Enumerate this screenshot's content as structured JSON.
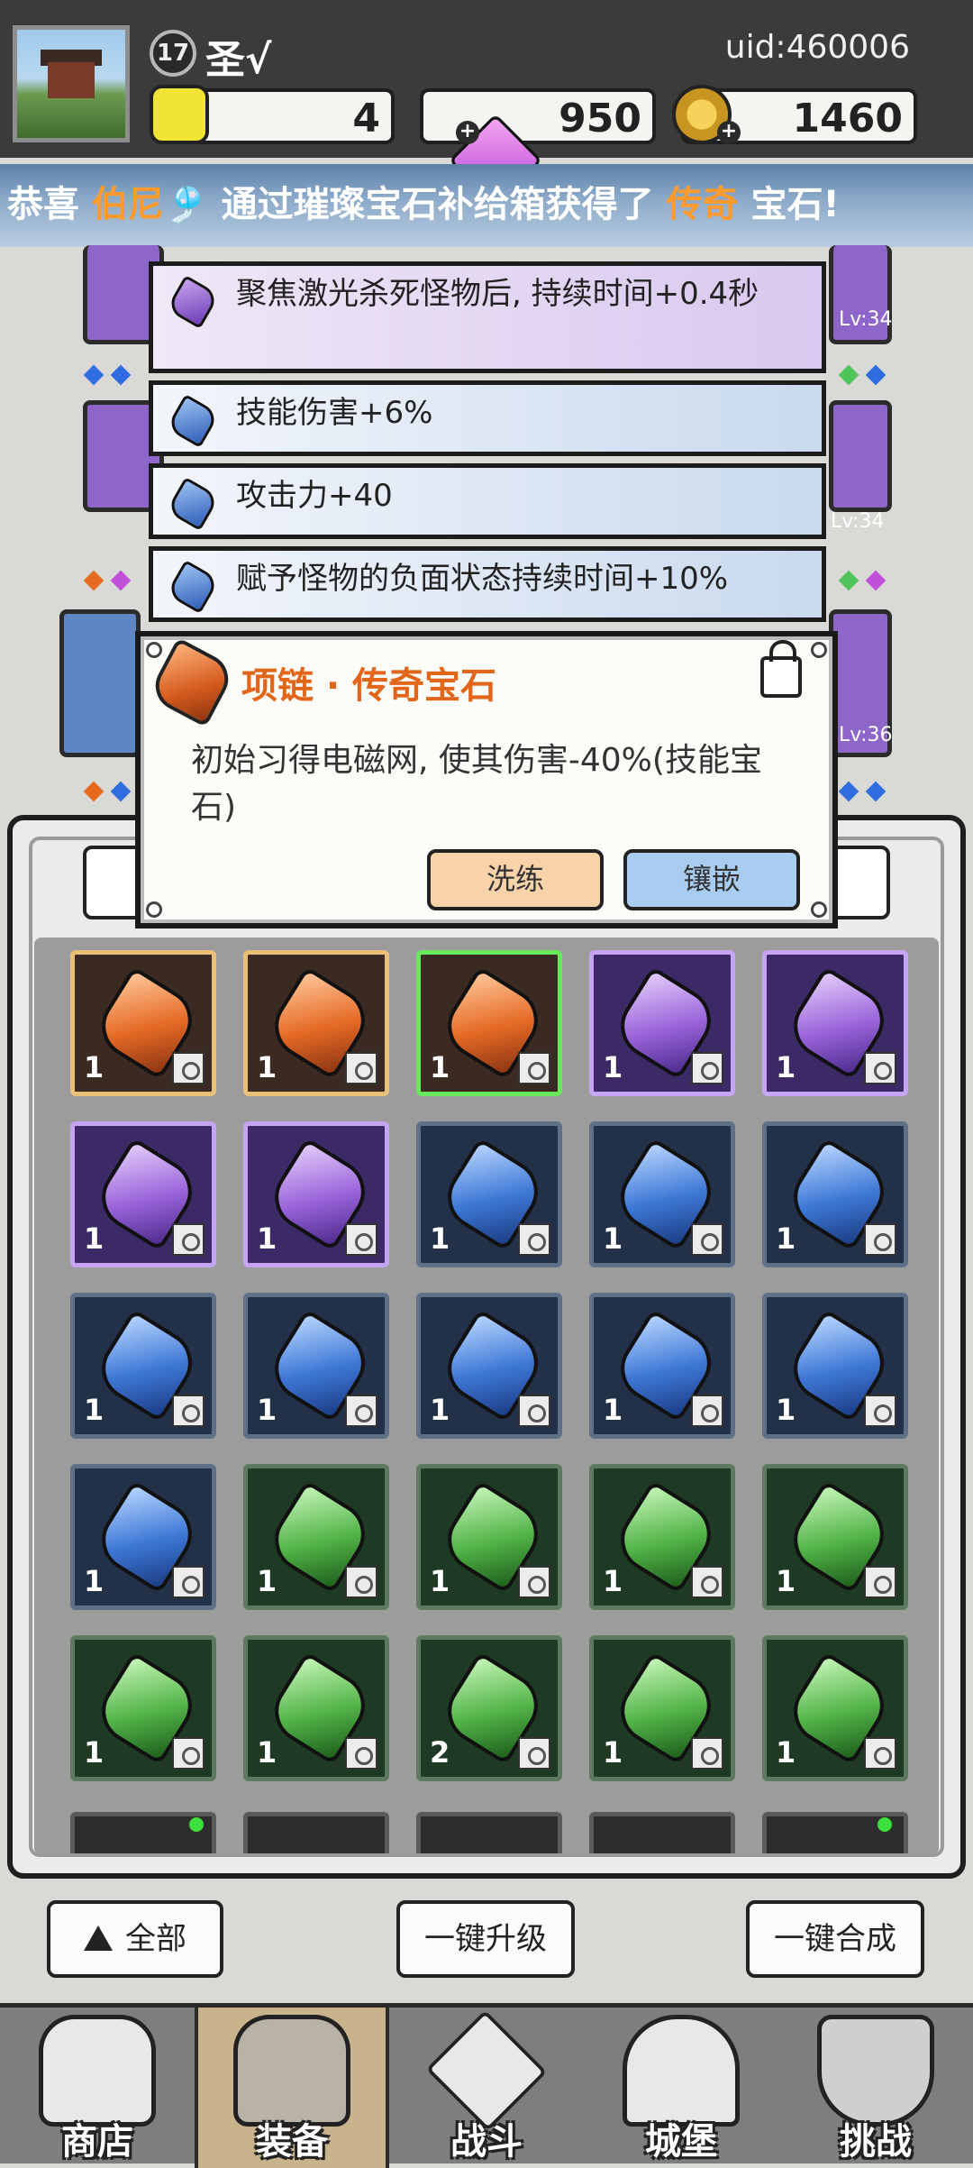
{
  "header": {
    "level": "17",
    "player_name": "圣√",
    "uid": "uid:460006",
    "resources": [
      {
        "name": "gold-hex",
        "value": "4"
      },
      {
        "name": "diamond",
        "value": "950"
      },
      {
        "name": "coin",
        "value": "1460"
      }
    ]
  },
  "marquee": {
    "prefix": "恭喜 ",
    "player": "伯尼🎐",
    "middle": " 通过璀璨宝石补给箱获得了 ",
    "rarity": "传奇",
    "suffix": " 宝石!"
  },
  "background_slots": {
    "levels": [
      "Lv:34",
      "Lv:34",
      "Lv:36"
    ]
  },
  "gem_tooltips": [
    {
      "text": "聚焦激光杀死怪物后, 持续时间+0.4秒",
      "rarity": "purple"
    },
    {
      "text": "技能伤害+6%",
      "rarity": "blue"
    },
    {
      "text": "攻击力+40",
      "rarity": "blue"
    },
    {
      "text": "赋予怪物的负面状态持续时间+10%",
      "rarity": "blue"
    }
  ],
  "popup": {
    "title": "项链 · 传奇宝石",
    "description": "初始习得电磁网, 使其伤害-40%(技能宝石)",
    "refine_label": "洗练",
    "embed_label": "镶嵌"
  },
  "inventory": {
    "rows": [
      [
        {
          "rarity": "orange",
          "count": "1",
          "slot": "weapon"
        },
        {
          "rarity": "orange",
          "count": "1",
          "slot": "helmet"
        },
        {
          "rarity": "orange",
          "count": "1",
          "slot": "necklace",
          "selected": true
        },
        {
          "rarity": "purple",
          "count": "1",
          "slot": "ring"
        },
        {
          "rarity": "purple",
          "count": "1",
          "slot": "armor"
        }
      ],
      [
        {
          "rarity": "purple",
          "count": "1",
          "slot": "boots"
        },
        {
          "rarity": "purple",
          "count": "1",
          "slot": "necklace"
        },
        {
          "rarity": "blue",
          "count": "1",
          "slot": "ring"
        },
        {
          "rarity": "blue",
          "count": "1",
          "slot": "ring"
        },
        {
          "rarity": "blue",
          "count": "1",
          "slot": "boots"
        }
      ],
      [
        {
          "rarity": "blue",
          "count": "1",
          "slot": "boots"
        },
        {
          "rarity": "blue",
          "count": "1",
          "slot": "boots"
        },
        {
          "rarity": "blue",
          "count": "1",
          "slot": "weapon"
        },
        {
          "rarity": "blue",
          "count": "1",
          "slot": "helmet"
        },
        {
          "rarity": "blue",
          "count": "1",
          "slot": "necklace"
        }
      ],
      [
        {
          "rarity": "blue",
          "count": "1",
          "slot": "necklace"
        },
        {
          "rarity": "green",
          "count": "1",
          "slot": "ring"
        },
        {
          "rarity": "green",
          "count": "1",
          "slot": "ring"
        },
        {
          "rarity": "green",
          "count": "1",
          "slot": "ring"
        },
        {
          "rarity": "green",
          "count": "1",
          "slot": "ring"
        }
      ],
      [
        {
          "rarity": "green",
          "count": "1",
          "slot": "armor"
        },
        {
          "rarity": "green",
          "count": "1",
          "slot": "boots"
        },
        {
          "rarity": "green",
          "count": "2",
          "slot": "boots"
        },
        {
          "rarity": "green",
          "count": "1",
          "slot": "weapon"
        },
        {
          "rarity": "green",
          "count": "1",
          "slot": "weapon"
        }
      ]
    ]
  },
  "actions": {
    "filter_label": "全部",
    "upgrade_all_label": "一键升级",
    "merge_all_label": "一键合成"
  },
  "nav": [
    {
      "label": "商店",
      "icon": "shop-icon"
    },
    {
      "label": "装备",
      "icon": "backpack-icon",
      "active": true
    },
    {
      "label": "战斗",
      "icon": "swords-icon"
    },
    {
      "label": "城堡",
      "icon": "castle-icon"
    },
    {
      "label": "挑战",
      "icon": "shield-icon"
    }
  ],
  "colors": {
    "legendary": "#e2661a",
    "epic": "#9a64da",
    "rare": "#3d78d6",
    "uncommon": "#52b447",
    "selected": "#68e85a"
  }
}
